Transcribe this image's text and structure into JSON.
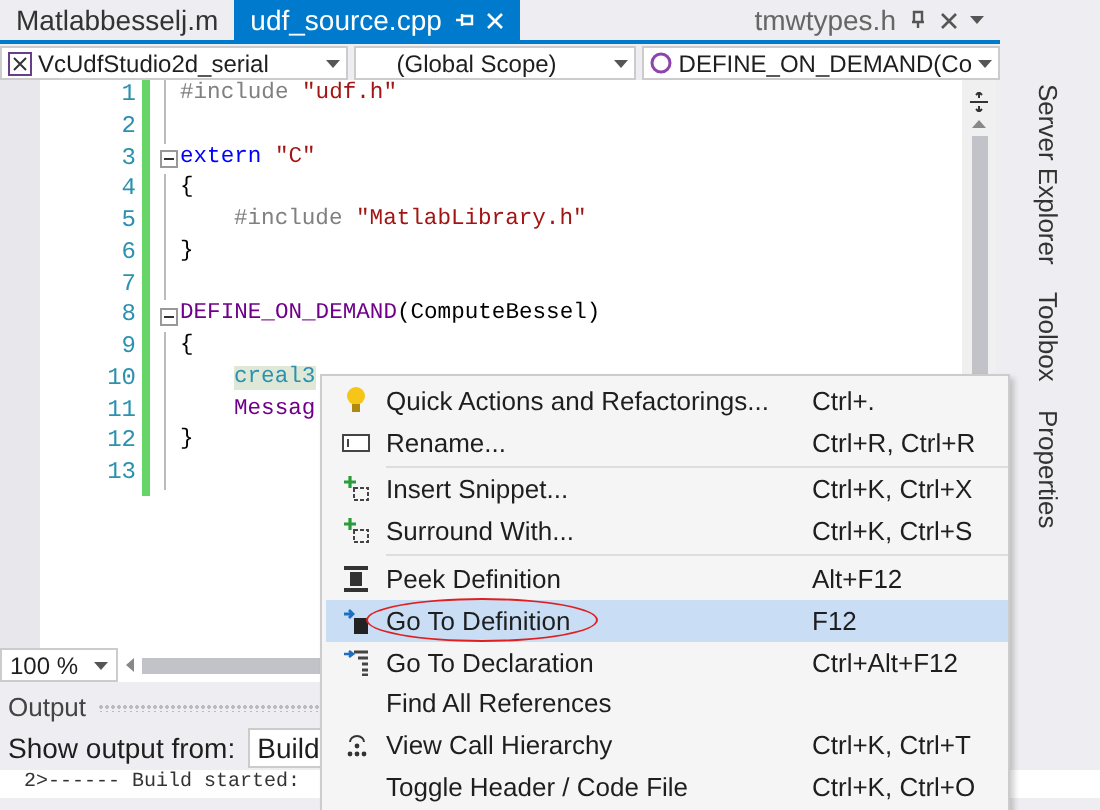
{
  "tabs": [
    {
      "label": "Matlabbesselj.m",
      "selected": false,
      "pinned": false
    },
    {
      "label": "udf_source.cpp",
      "selected": true,
      "pinned": false
    },
    {
      "label": "tmwtypes.h",
      "selected": false,
      "pinned": true
    }
  ],
  "nav_bar": {
    "project": "VcUdfStudio2d_serial",
    "scope": "(Global Scope)",
    "member": "DEFINE_ON_DEMAND(Co"
  },
  "code_lines": [
    {
      "number": "1",
      "fold_start": false,
      "tokens": [
        {
          "text": "#include ",
          "kind": "preproc"
        },
        {
          "text": "\"udf.h\"",
          "kind": "string"
        }
      ]
    },
    {
      "number": "2",
      "fold_start": false
    },
    {
      "number": "3",
      "fold_start": true,
      "tokens": [
        {
          "text": "extern ",
          "kind": "keyword"
        },
        {
          "text": "\"C\"",
          "kind": "string"
        }
      ]
    },
    {
      "number": "4",
      "fold_start": false,
      "tokens": [
        {
          "text": "{",
          "kind": "plain"
        }
      ]
    },
    {
      "number": "5",
      "fold_start": false,
      "indented": true,
      "tokens": [
        {
          "text": "#include ",
          "kind": "preproc"
        },
        {
          "text": "\"MatlabLibrary.h\"",
          "kind": "string"
        }
      ]
    },
    {
      "number": "6",
      "fold_start": false,
      "tokens": [
        {
          "text": "}",
          "kind": "plain"
        }
      ]
    },
    {
      "number": "7",
      "fold_start": false
    },
    {
      "number": "8",
      "fold_start": true,
      "tokens": [
        {
          "text": "DEFINE_ON_DEMAND",
          "kind": "macro"
        },
        {
          "text": "(ComputeBessel)",
          "kind": "plain"
        }
      ]
    },
    {
      "number": "9",
      "fold_start": false,
      "tokens": [
        {
          "text": "{",
          "kind": "plain"
        }
      ]
    },
    {
      "number": "10",
      "fold_start": false,
      "indented": true,
      "tokens": [
        {
          "text": "creal3",
          "kind": "highlight"
        }
      ]
    },
    {
      "number": "11",
      "fold_start": false,
      "indented": true,
      "tokens": [
        {
          "text": "Messag",
          "kind": "macro"
        }
      ]
    },
    {
      "number": "12",
      "fold_start": false,
      "tokens": [
        {
          "text": "}",
          "kind": "plain"
        }
      ]
    },
    {
      "number": "13",
      "fold_start": false
    }
  ],
  "side_tabs": [
    "Server Explorer",
    "Toolbox",
    "Properties"
  ],
  "zoom": "100 %",
  "output": {
    "title": "Output",
    "show_from_label": "Show output from:",
    "source": "Build",
    "text": "2>------ Build started:"
  },
  "context_menu": [
    {
      "kind": "item",
      "label": "Quick Actions and Refactorings...",
      "shortcut": "Ctrl+.",
      "selected": false,
      "circled": false
    },
    {
      "kind": "item",
      "label": "Rename...",
      "shortcut": "Ctrl+R, Ctrl+R",
      "selected": false,
      "circled": false
    },
    {
      "kind": "separator"
    },
    {
      "kind": "item",
      "label": "Insert Snippet...",
      "shortcut": "Ctrl+K, Ctrl+X",
      "selected": false,
      "circled": false
    },
    {
      "kind": "item",
      "label": "Surround With...",
      "shortcut": "Ctrl+K, Ctrl+S",
      "selected": false,
      "circled": false
    },
    {
      "kind": "separator"
    },
    {
      "kind": "item",
      "label": "Peek Definition",
      "shortcut": "Alt+F12",
      "selected": false,
      "circled": false
    },
    {
      "kind": "item",
      "label": "Go To Definition",
      "shortcut": "F12",
      "selected": true,
      "circled": true
    },
    {
      "kind": "item",
      "label": "Go To Declaration",
      "shortcut": "Ctrl+Alt+F12",
      "selected": false,
      "circled": false
    },
    {
      "kind": "item",
      "label": "Find All References",
      "selected": false,
      "circled": false
    },
    {
      "kind": "item",
      "label": "View Call Hierarchy",
      "shortcut": "Ctrl+K, Ctrl+T",
      "selected": false,
      "circled": false
    },
    {
      "kind": "item",
      "label": "Toggle Header / Code File",
      "shortcut": "Ctrl+K, Ctrl+O",
      "selected": false,
      "circled": false
    }
  ]
}
